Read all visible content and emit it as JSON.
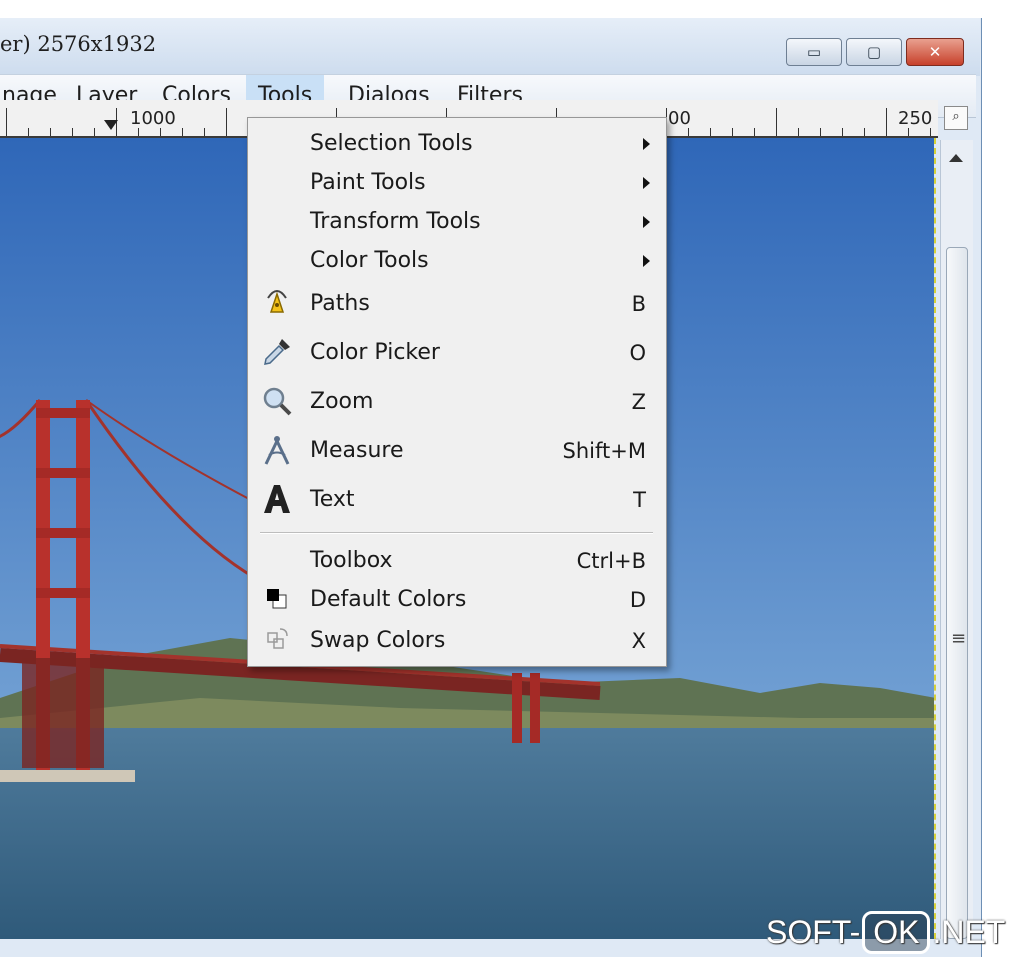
{
  "window": {
    "title": "er) 2576x1932",
    "buttons": {
      "minimize": "▭",
      "maximize": "▢",
      "close": "✕"
    }
  },
  "menubar": {
    "items": [
      {
        "label": "nage",
        "active": false
      },
      {
        "label": "Layer",
        "active": false
      },
      {
        "label": "Colors",
        "active": false
      },
      {
        "label": "Tools",
        "active": true
      },
      {
        "label": "Dialogs",
        "active": false
      },
      {
        "label": "Filters",
        "active": false
      }
    ]
  },
  "ruler": {
    "labels": [
      "1000",
      "00",
      "250"
    ]
  },
  "tools_menu": {
    "items": [
      {
        "label": "Selection Tools",
        "accel": "",
        "submenu": true,
        "icon": ""
      },
      {
        "label": "Paint Tools",
        "accel": "",
        "submenu": true,
        "icon": ""
      },
      {
        "label": "Transform Tools",
        "accel": "",
        "submenu": true,
        "icon": ""
      },
      {
        "label": "Color Tools",
        "accel": "",
        "submenu": true,
        "icon": ""
      },
      {
        "label": "Paths",
        "accel": "B",
        "submenu": false,
        "icon": "paths-icon"
      },
      {
        "label": "Color Picker",
        "accel": "O",
        "submenu": false,
        "icon": "color-picker-icon"
      },
      {
        "label": "Zoom",
        "accel": "Z",
        "submenu": false,
        "icon": "zoom-icon"
      },
      {
        "label": "Measure",
        "accel": "Shift+M",
        "submenu": false,
        "icon": "measure-icon"
      },
      {
        "label": "Text",
        "accel": "T",
        "submenu": false,
        "icon": "text-icon"
      },
      {
        "label": "Toolbox",
        "accel": "Ctrl+B",
        "submenu": false,
        "icon": ""
      },
      {
        "label": "Default Colors",
        "accel": "D",
        "submenu": false,
        "icon": "default-colors-icon"
      },
      {
        "label": "Swap Colors",
        "accel": "X",
        "submenu": false,
        "icon": "swap-colors-icon"
      }
    ]
  },
  "watermark": {
    "left": "SOFT-",
    "box": "OK",
    "right": ".NET"
  },
  "colors": {
    "sky_top": "#2f67b8",
    "sky_bottom": "#88b4dc",
    "bridge": "#b8312c",
    "water": "#3d6a8d",
    "menu_highlight": "#c9e0f6"
  }
}
